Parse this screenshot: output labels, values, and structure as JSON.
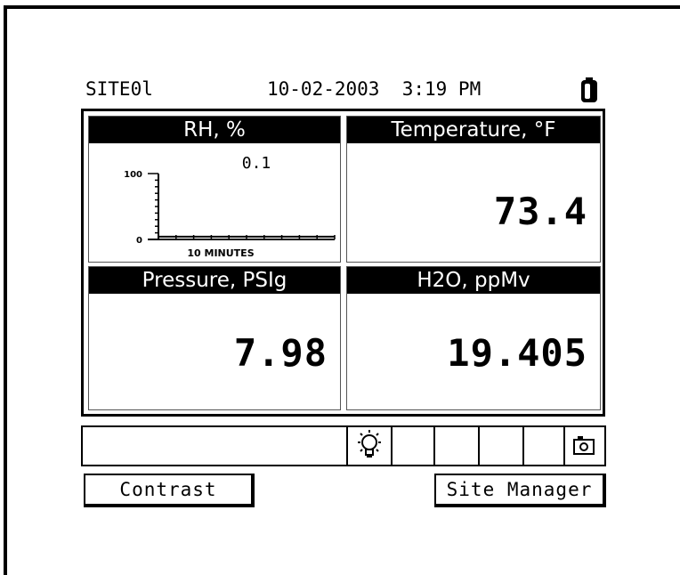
{
  "status_bar": {
    "site": "SITE0l",
    "datetime": "10-02-2003  3:19 PM",
    "battery_icon": "battery-icon"
  },
  "cells": {
    "rh": {
      "header": "RH, %",
      "current": "0.1",
      "y_top": "100",
      "y_bottom": "0",
      "x_label": "10 MINUTES"
    },
    "temperature": {
      "header": "Temperature, °F",
      "value": "73.4"
    },
    "pressure": {
      "header": "Pressure, PSIg",
      "value": "7.98"
    },
    "h2o": {
      "header": "H2O, ppMv",
      "value": "19.405"
    }
  },
  "chart_data": {
    "type": "line",
    "title": "RH, %",
    "xlabel": "10 MINUTES",
    "ylabel": "",
    "ylim": [
      0,
      100
    ],
    "x": [
      0,
      1,
      2,
      3,
      4,
      5,
      6,
      7,
      8,
      9,
      10
    ],
    "series": [
      {
        "values": [
          0.1,
          0.1,
          0.1,
          0.1,
          0.1,
          0.1,
          0.1,
          0.1,
          0.1,
          0.1,
          0.1
        ]
      }
    ]
  },
  "icon_bar": {
    "icons": [
      "lightbulb-icon",
      "camera-icon"
    ]
  },
  "buttons": {
    "contrast": "Contrast",
    "site_manager": "Site Manager"
  }
}
